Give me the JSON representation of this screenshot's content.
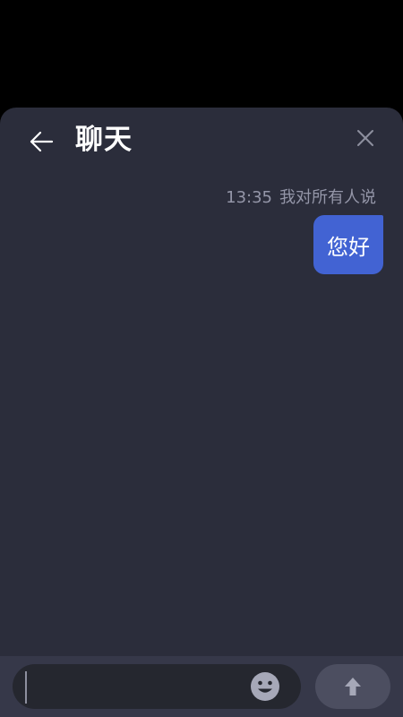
{
  "header": {
    "title": "聊天",
    "back_icon": "arrow-left-icon",
    "close_icon": "close-icon"
  },
  "messages": [
    {
      "time": "13:35",
      "recipient": "我对所有人说",
      "text": "您好",
      "bubble_color": "#4263d3"
    }
  ],
  "composer": {
    "input_value": "",
    "emoji_icon": "emoji-smile-icon",
    "send_icon": "send-arrow-up-icon"
  },
  "colors": {
    "panel_bg": "#2b2d3b",
    "footer_bg": "#363849",
    "accent": "#4263d3"
  }
}
